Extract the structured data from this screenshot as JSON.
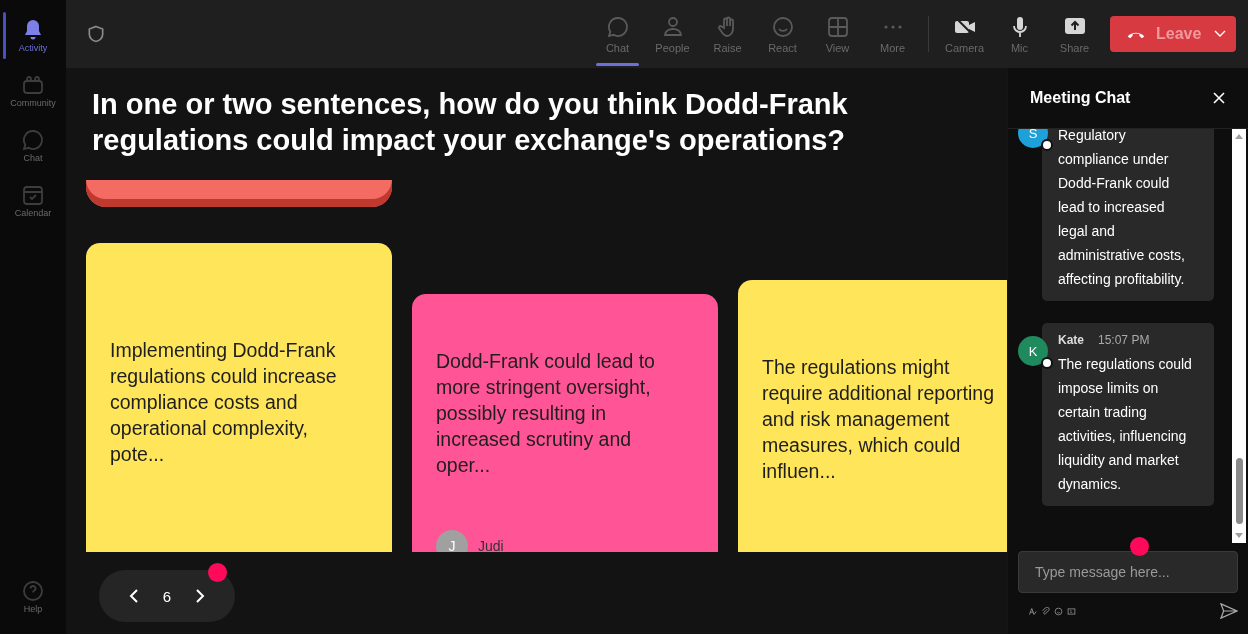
{
  "rail": [
    {
      "label": "Activity",
      "selected": true
    },
    {
      "label": "Community",
      "selected": false
    },
    {
      "label": "Chat",
      "selected": false
    },
    {
      "label": "Calendar",
      "selected": false
    }
  ],
  "help": {
    "label": "Help"
  },
  "toolbar": [
    {
      "label": "Chat",
      "selected": true
    },
    {
      "label": "People",
      "selected": false
    },
    {
      "label": "Raise",
      "selected": false
    },
    {
      "label": "React",
      "selected": false
    },
    {
      "label": "View",
      "selected": false
    },
    {
      "label": "More",
      "selected": false
    }
  ],
  "devices": [
    {
      "label": "Camera"
    },
    {
      "label": "Mic"
    },
    {
      "label": "Share"
    }
  ],
  "leave": {
    "label": "Leave"
  },
  "question": "In one or two sentences, how do you think Dodd-Frank regulations could impact your exchange's operations?",
  "cards": [
    {
      "color": "#ffe55a",
      "text": "Implementing Dodd-Frank regulations could increase compliance costs and operational complexity, pote..."
    },
    {
      "color": "#ff5596",
      "text": "Dodd-Frank could lead to more stringent oversight, possibly resulting in increased scrutiny and oper...",
      "author": "Judi",
      "initial": "J"
    },
    {
      "color": "#ffe55a",
      "text": "The regulations might require additional reporting and risk management measures, which could influen..."
    }
  ],
  "pager": {
    "page": "6",
    "notification": true
  },
  "chat": {
    "title": "Meeting Chat",
    "messages": [
      {
        "initial": "S",
        "color": "#1ea1d9",
        "text": "Regulatory compliance under Dodd-Frank could lead to increased legal and administrative costs, affecting profitability."
      },
      {
        "initial": "K",
        "color": "#1f8a5e",
        "name": "Kate",
        "time": "15:07 PM",
        "text": "The regulations could impose limits on certain trading activities, influencing liquidity and market dynamics."
      }
    ],
    "input": {
      "placeholder": "Type message here...",
      "notification": true
    }
  }
}
